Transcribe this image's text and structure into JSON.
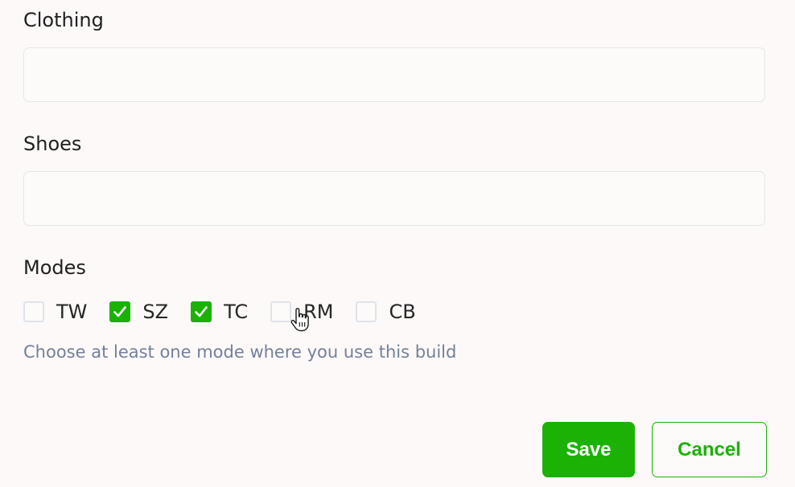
{
  "form": {
    "clothing": {
      "label": "Clothing",
      "value": "",
      "placeholder": ""
    },
    "shoes": {
      "label": "Shoes",
      "value": "",
      "placeholder": ""
    },
    "modes": {
      "label": "Modes",
      "options": [
        {
          "label": "TW",
          "checked": false
        },
        {
          "label": "SZ",
          "checked": true
        },
        {
          "label": "TC",
          "checked": true
        },
        {
          "label": "RM",
          "checked": false
        },
        {
          "label": "CB",
          "checked": false
        }
      ],
      "hint": "Choose at least one mode where you use this build"
    }
  },
  "actions": {
    "save_label": "Save",
    "cancel_label": "Cancel"
  },
  "colors": {
    "accent": "#1bb205",
    "hint": "#73819a",
    "background": "#fcf9f8"
  },
  "icons": {
    "check": "checkmark-icon",
    "pointer": "hand-pointer-cursor-icon"
  }
}
